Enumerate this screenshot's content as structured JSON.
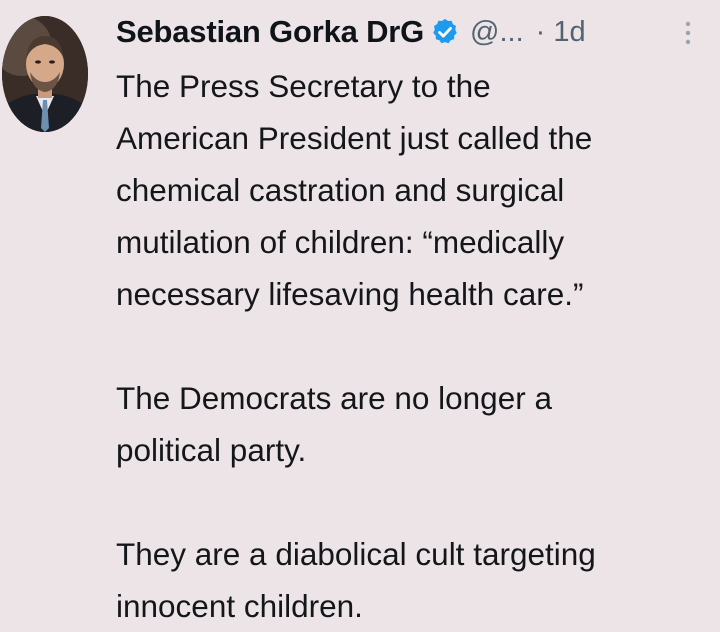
{
  "author": {
    "name": "Sebastian Gorka DrG",
    "handle": "@...",
    "separator": "·",
    "time": "1d",
    "verified_icon": "verified-badge-icon",
    "verified_color": "#1d9bf0"
  },
  "tweet": {
    "paragraphs": [
      "The Press Secretary to the\nAmerican President just called the\nchemical castration and surgical\nmutilation of children: “medically\nnecessary lifesaving health care.”",
      "The Democrats are no longer a\npolitical party.",
      "They are a diabolical cult targeting\ninnocent children."
    ]
  },
  "colors": {
    "background": "#ede4e8",
    "text": "#14171a",
    "secondary": "#536471"
  }
}
